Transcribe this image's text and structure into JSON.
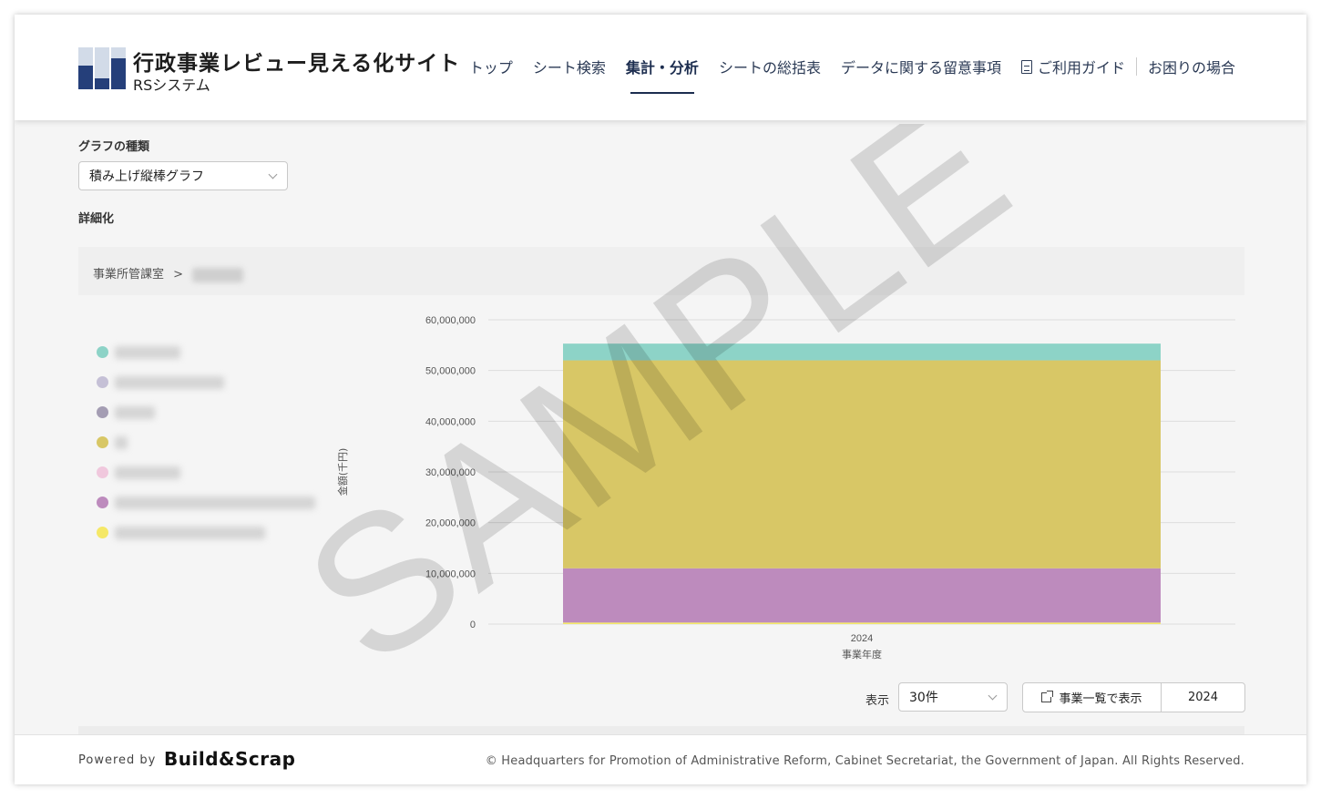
{
  "header": {
    "title": "行政事業レビュー見える化サイト",
    "subtitle": "RSシステム",
    "nav": [
      {
        "label": "トップ",
        "active": false
      },
      {
        "label": "シート検索",
        "active": false
      },
      {
        "label": "集計・分析",
        "active": true
      },
      {
        "label": "シートの総括表",
        "active": false
      },
      {
        "label": "データに関する留意事項",
        "active": false
      },
      {
        "label": "ご利用ガイド",
        "active": false,
        "icon": "document-icon"
      },
      {
        "label": "お困りの場合",
        "active": false
      }
    ]
  },
  "controls": {
    "graph_type_label": "グラフの種類",
    "graph_type_value": "積み上げ縦棒グラフ",
    "detail_label": "詳細化",
    "breadcrumb_root": "事業所管課室",
    "breadcrumb_sep": ">"
  },
  "legend": [
    {
      "color": "#8dd3c7"
    },
    {
      "color": "#c5c0d6"
    },
    {
      "color": "#a49db3"
    },
    {
      "color": "#d8c766"
    },
    {
      "color": "#f0c8dd"
    },
    {
      "color": "#bd8bbd"
    },
    {
      "color": "#f5e867"
    }
  ],
  "chart_data": {
    "type": "bar",
    "stacked": true,
    "categories": [
      "2024"
    ],
    "xlabel": "事業年度",
    "ylabel": "金額(千円)",
    "ylim": [
      0,
      60000000
    ],
    "yticks": [
      "0",
      "10,000,000",
      "20,000,000",
      "30,000,000",
      "40,000,000",
      "50,000,000",
      "60,000,000"
    ],
    "grid": true,
    "series": [
      {
        "values": [
          300000
        ],
        "color": "#f5e867"
      },
      {
        "values": [
          10700000
        ],
        "color": "#bd8bbd"
      },
      {
        "values": [
          41000000
        ],
        "color": "#d8c766"
      },
      {
        "values": [
          3300000
        ],
        "color": "#8dd3c7"
      }
    ]
  },
  "bottom": {
    "display_label": "表示",
    "display_value": "30件",
    "list_button": "事業一覧で表示",
    "year_button": "2024"
  },
  "watermark": "SAMPLE",
  "footer": {
    "powered": "Powered by",
    "brand": "Build&Scrap",
    "copyright": "© Headquarters for Promotion of Administrative Reform, Cabinet Secretariat, the Government of Japan. All Rights Reserved."
  }
}
